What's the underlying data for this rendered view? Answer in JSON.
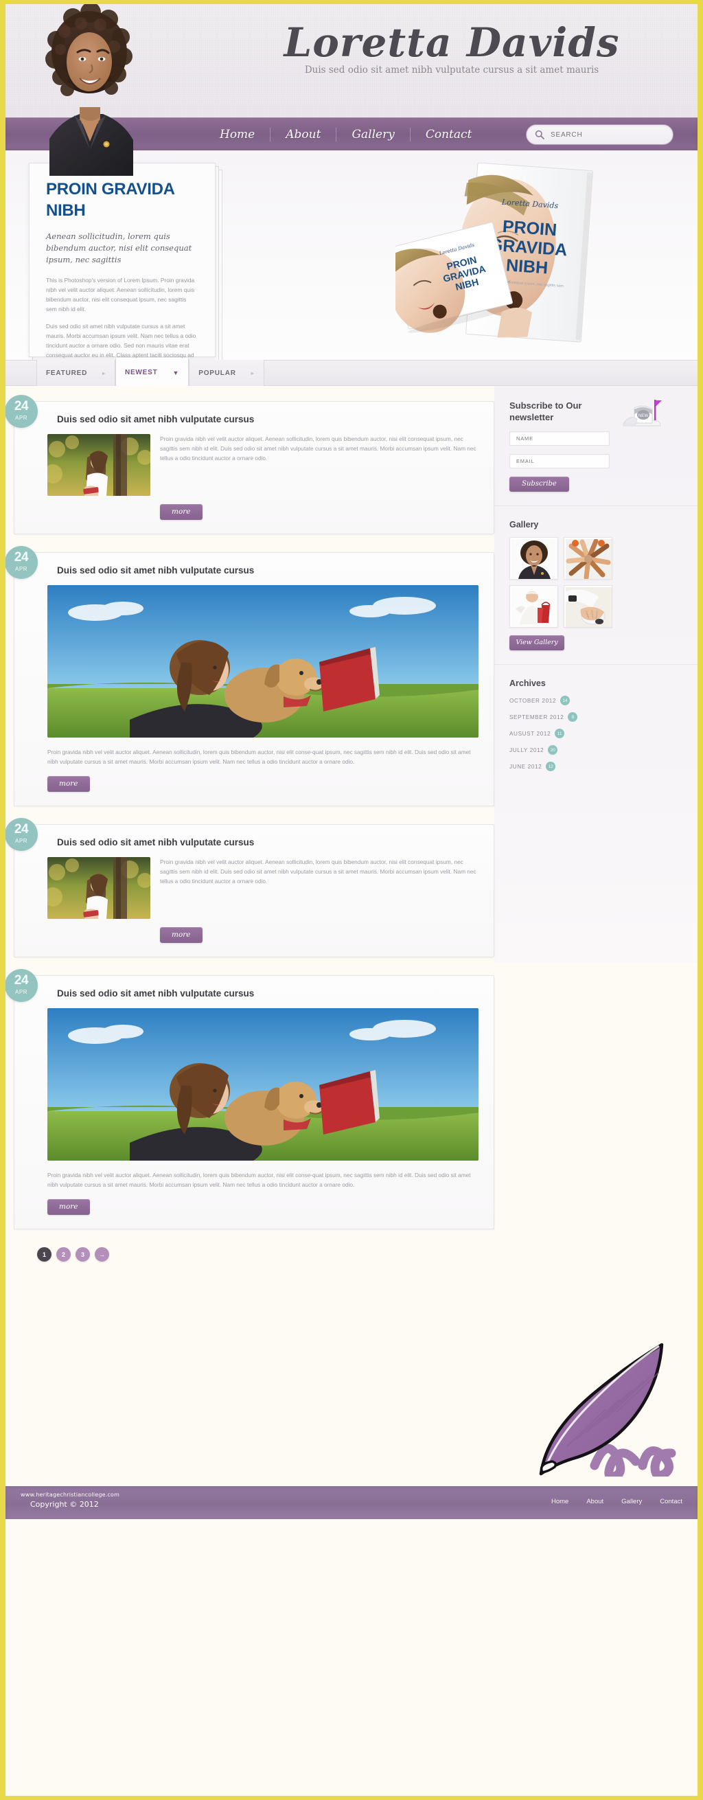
{
  "brand": {
    "title": "Loretta Davids",
    "tagline": "Duis sed odio sit amet nibh vulputate cursus a sit amet mauris"
  },
  "nav": {
    "items": [
      "Home",
      "About",
      "Gallery",
      "Contact"
    ]
  },
  "search": {
    "placeholder": "SEARCH",
    "value": "",
    "icon": "search-icon"
  },
  "hero": {
    "heading": "PROIN GRAVIDA NIBH",
    "subheading": "Aenean sollicitudin, lorem quis bibendum auctor, nisi elit consequat ipsum, nec sagittis",
    "paragraph1": "This is Photoshop's version  of Lorem Ipsum. Proin gravida nibh vel velit auctor aliquet. Aenean sollicitudin, lorem quis bibendum auctor, nisi elit consequat ipsum, nec sagittis sem nibh id elit.",
    "paragraph2": "Duis sed odio sit amet nibh vulputate cursus a sit amet mauris. Morbi accumsan ipsum velit. Nam nec tellus a odio tincidunt auctor a ornare odio. Sed non  mauris vitae erat consequat auctor eu in elit. Class aptent taciti sociosqu ad litora torquent per ",
    "book_author": "Loretta Davids",
    "book_title": "PROIN GRAVIDA NIBH"
  },
  "tabs": [
    {
      "label": "FEATURED",
      "arrow": "▸",
      "active": false
    },
    {
      "label": "NEWEST",
      "arrow": "▼",
      "active": true
    },
    {
      "label": "POPULAR",
      "arrow": "▸",
      "active": false
    }
  ],
  "posts": [
    {
      "day": "24",
      "month": "APR",
      "title": "Duis sed odio sit amet nibh vulputate cursus",
      "layout": "thumb",
      "text": "Proin gravida nibh vel velit auctor aliquet. Aenean sollicitudin, lorem quis bibendum auctor, nisi elit consequat ipsum, nec sagittis sem nibh id elit. Duis sed odio sit amet nibh vulputate cursus a sit amet mauris. Morbi accumsan ipsum velit. Nam nec tellus a odio tincidunt auctor a ornare odio.",
      "more_label": "more",
      "image": "girl-reading-autumn"
    },
    {
      "day": "24",
      "month": "APR",
      "title": "Duis sed odio sit amet nibh vulputate cursus",
      "layout": "wide",
      "text": "Proin gravida nibh vel velit auctor aliquet. Aenean sollicitudin, lorem quis bibendum auctor, nisi elit conse-quat ipsum, nec sagittis sem nibh id elit. Duis sed odio sit amet nibh vulputate cursus a sit amet mauris. Morbi accumsan ipsum velit. Nam nec tellus a odio tincidunt auctor a ornare odio.",
      "more_label": "more",
      "image": "woman-dog-book-field"
    },
    {
      "day": "24",
      "month": "APR",
      "title": "Duis sed odio sit amet nibh vulputate cursus",
      "layout": "thumb",
      "text": "Proin gravida nibh vel velit auctor aliquet. Aenean sollicitudin, lorem quis bibendum auctor, nisi elit consequat ipsum, nec sagittis sem nibh id elit. Duis sed odio sit amet nibh vulputate cursus a sit amet mauris. Morbi accumsan ipsum velit. Nam nec tellus a odio tincidunt auctor a ornare odio.",
      "more_label": "more",
      "image": "girl-reading-autumn"
    },
    {
      "day": "24",
      "month": "APR",
      "title": "Duis sed odio sit amet nibh vulputate cursus",
      "layout": "wide",
      "text": "Proin gravida nibh vel velit auctor aliquet. Aenean sollicitudin, lorem quis bibendum auctor, nisi elit conse-quat ipsum, nec sagittis sem nibh id elit. Duis sed odio sit amet nibh vulputate cursus a sit amet mauris. Morbi accumsan ipsum velit. Nam nec tellus a odio tincidunt auctor a ornare odio.",
      "more_label": "more",
      "image": "woman-dog-book-field"
    }
  ],
  "pagination": {
    "pages": [
      "1",
      "2",
      "3"
    ],
    "current": "1",
    "next_icon": "→"
  },
  "sidebar": {
    "subscribe": {
      "title": "Subscribe to Our newsletter",
      "name_placeholder": "NAME",
      "name_value": "",
      "email_placeholder": "EMAIL",
      "email_value": "",
      "button_label": "Subscribe",
      "icon": "mailbox-icon"
    },
    "gallery": {
      "title": "Gallery",
      "button_label": "View Gallery",
      "items": [
        "portrait-woman-smiling",
        "hands-together-circle",
        "woman-shopping-bags",
        "hand-on-mouse"
      ]
    },
    "archives": {
      "title": "Archives",
      "rows": [
        {
          "label": "OCTOBER 2012",
          "count": "14"
        },
        {
          "label": "SEPTEMBER 2012",
          "count": "8"
        },
        {
          "label": "AUSUST 2012",
          "count": "11"
        },
        {
          "label": "JULLY 2012",
          "count": "20"
        },
        {
          "label": "JUNE 2012",
          "count": "12"
        }
      ]
    }
  },
  "footer": {
    "url": "www.heritagechristiancollege.com",
    "copyright": "Copyright © 2012",
    "nav": [
      "Home",
      "About",
      "Gallery",
      "Contact"
    ]
  },
  "colors": {
    "frame": "#e8d94a",
    "purple": "#8a6b91",
    "purple_btn": "#9a75a2",
    "teal_badge": "#93c4bf",
    "hero_blue": "#14508c",
    "page_bg": "#fdfbf4"
  },
  "decor": {
    "quill": "quill-pen-icon"
  }
}
